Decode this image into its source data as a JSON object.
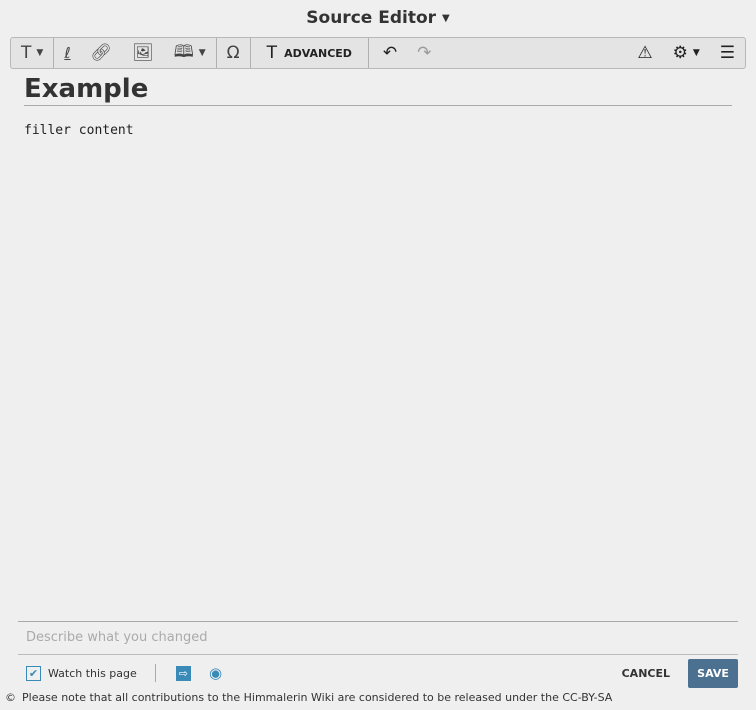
{
  "header": {
    "title": "Source Editor"
  },
  "toolbar": {
    "advanced": "ADVANCED"
  },
  "document": {
    "heading": "Example",
    "body": "filler content"
  },
  "footer": {
    "summary_placeholder": "Describe what you changed",
    "watch_label": "Watch this page",
    "watch_checked": true,
    "cancel": "CANCEL",
    "save": "SAVE",
    "license_note": "Please note that all contributions to the Himmalerin Wiki are considered to be released under the CC-BY-SA"
  }
}
